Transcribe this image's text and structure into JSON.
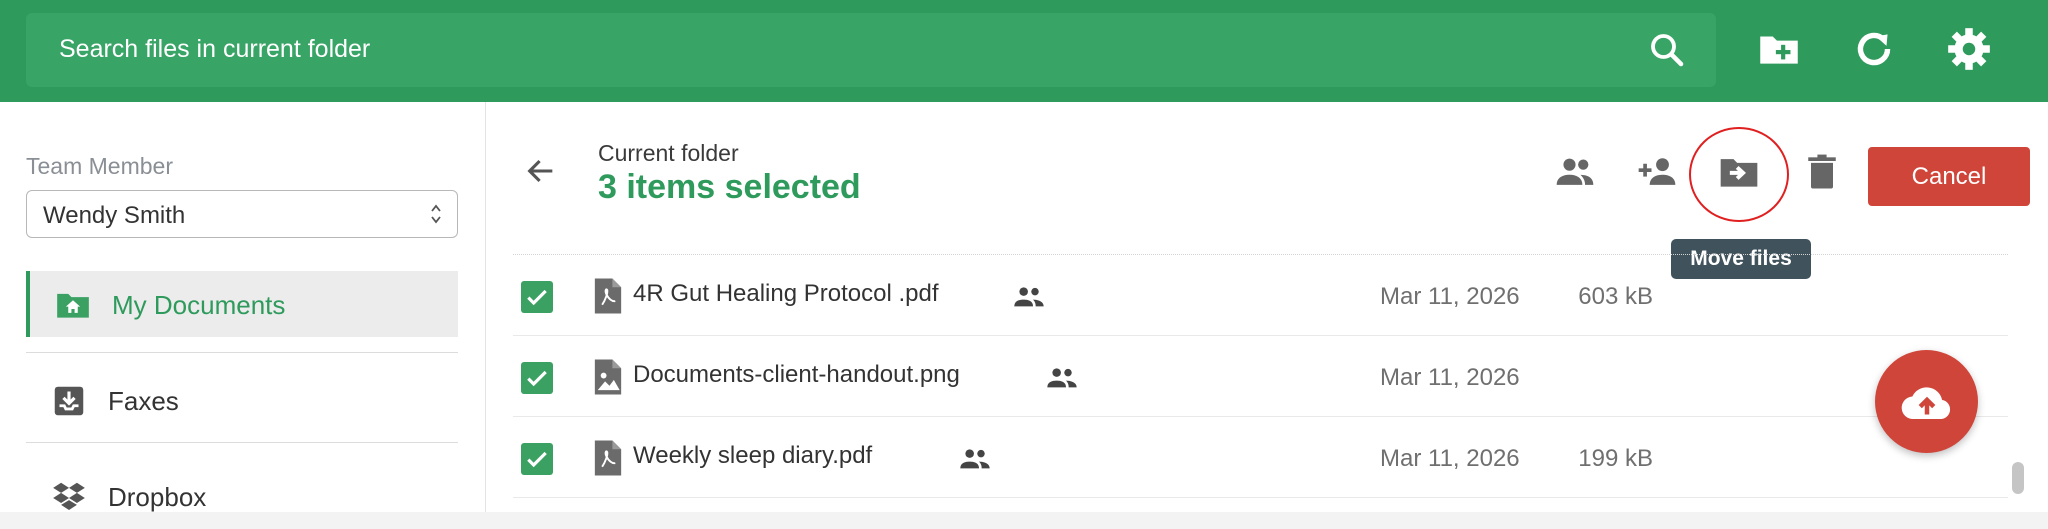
{
  "search": {
    "placeholder": "Search files in current folder"
  },
  "toolbar_icons": [
    "search-icon",
    "new-folder-icon",
    "refresh-icon",
    "settings-icon"
  ],
  "sidebar": {
    "team_member_label": "Team Member",
    "team_member_value": "Wendy Smith",
    "items": [
      {
        "label": "My Documents",
        "icon": "home-folder-icon",
        "active": true
      },
      {
        "label": "Faxes",
        "icon": "inbox-download-icon",
        "active": false
      },
      {
        "label": "Dropbox",
        "icon": "dropbox-icon",
        "active": false
      }
    ]
  },
  "header": {
    "current_folder_label": "Current folder",
    "selected_text": "3 items selected",
    "actions": [
      "share-icon",
      "add-person-icon",
      "move-files-icon",
      "trash-icon"
    ],
    "cancel_label": "Cancel",
    "tooltip": "Move files"
  },
  "files": [
    {
      "name": "4R Gut Healing Protocol .pdf",
      "type": "pdf",
      "shared": true,
      "checked": true,
      "date": "Mar 11, 2026",
      "size": "603 kB"
    },
    {
      "name": "Documents-client-handout.png",
      "type": "image",
      "shared": true,
      "checked": true,
      "date": "Mar 11, 2026",
      "size": ""
    },
    {
      "name": "Weekly sleep diary.pdf",
      "type": "pdf",
      "shared": true,
      "checked": true,
      "date": "Mar 11, 2026",
      "size": "199 kB"
    }
  ],
  "fab": {
    "icon": "cloud-upload-icon"
  },
  "colors": {
    "brand_green": "#2e9a5c",
    "danger_red": "#d0453a",
    "tooltip_bg": "#40525c"
  }
}
